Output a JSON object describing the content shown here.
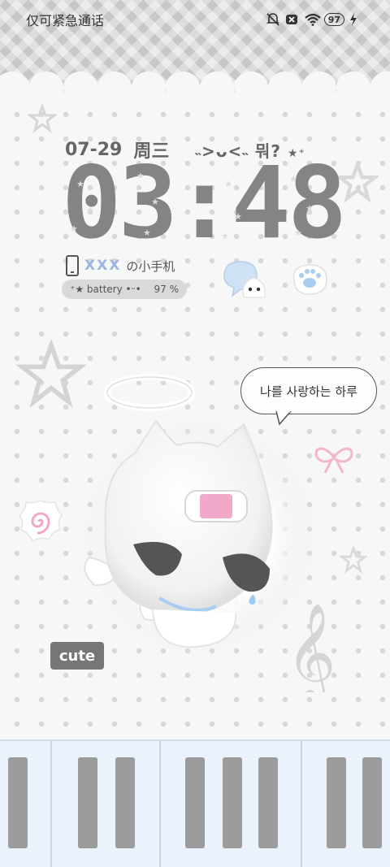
{
  "status_bar": {
    "carrier_text": "仅可紧急通话",
    "battery_level": "97",
    "icons": [
      "mute-icon",
      "sim-off-icon",
      "wifi-icon",
      "battery-icon",
      "charging-icon"
    ]
  },
  "lockscreen": {
    "date": "07-29",
    "weekday": "周三",
    "kaomoji": "˵>ᴗ<˵ 뭐?",
    "kaomoji_stars": "★⁺",
    "time": "03:48",
    "owner_name": "XXX",
    "owner_suffix": "の小手机",
    "battery_label": "battery",
    "battery_percent": "97 %",
    "speech_bubble": "나를 사랑하는 하루",
    "cute_badge": "cute"
  },
  "colors": {
    "clock": "#848484",
    "owner_name": "#9ab6e0",
    "ribbon_pink": "#f2b6cf",
    "bandage_pink": "#f2a8c8",
    "piano_bg": "#eaf3fc"
  }
}
